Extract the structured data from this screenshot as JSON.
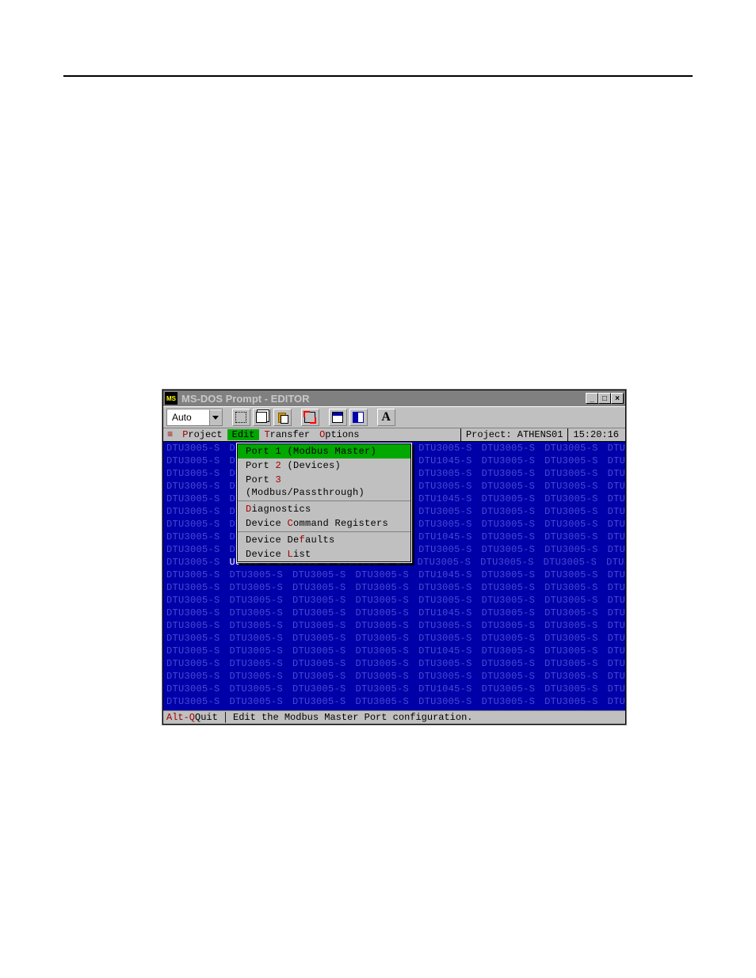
{
  "window": {
    "title": "MS-DOS Prompt - EDITOR"
  },
  "toolbar": {
    "combo_value": "Auto"
  },
  "menubar": {
    "items": [
      {
        "hot": "P",
        "rest": "roject"
      },
      {
        "hot": "E",
        "rest": "dit",
        "active": true
      },
      {
        "hot": "T",
        "rest": "ransfer"
      },
      {
        "hot": "O",
        "rest": "ptions"
      }
    ],
    "project_label": "Project:",
    "project_name": "ATHENS01",
    "clock": "15:20:16"
  },
  "edit_menu": {
    "groups": [
      [
        {
          "pre": "Port ",
          "hot": "1",
          "post": " (Modbus Master)",
          "selected": true
        },
        {
          "pre": "Port ",
          "hot": "2",
          "post": " (Devices)"
        },
        {
          "pre": "Port ",
          "hot": "3",
          "post": " (Modbus/Passthrough)"
        }
      ],
      [
        {
          "pre": "",
          "hot": "D",
          "post": "iagnostics"
        },
        {
          "pre": "Device ",
          "hot": "C",
          "post": "ommand Registers"
        }
      ],
      [
        {
          "pre": "Device De",
          "hot": "f",
          "post": "aults"
        },
        {
          "pre": "Device ",
          "hot": "L",
          "post": "ist"
        }
      ]
    ]
  },
  "background": {
    "token_a": "DTU3005-S",
    "token_b": "DTU1045-S",
    "visible_fragment": "U3005-S  DTU3005-S  DTU3005-S  DT"
  },
  "statusbar": {
    "quit_hot": "Alt-Q",
    "quit_label": " Quit",
    "hint": "Edit the Modbus Master Port configuration."
  }
}
